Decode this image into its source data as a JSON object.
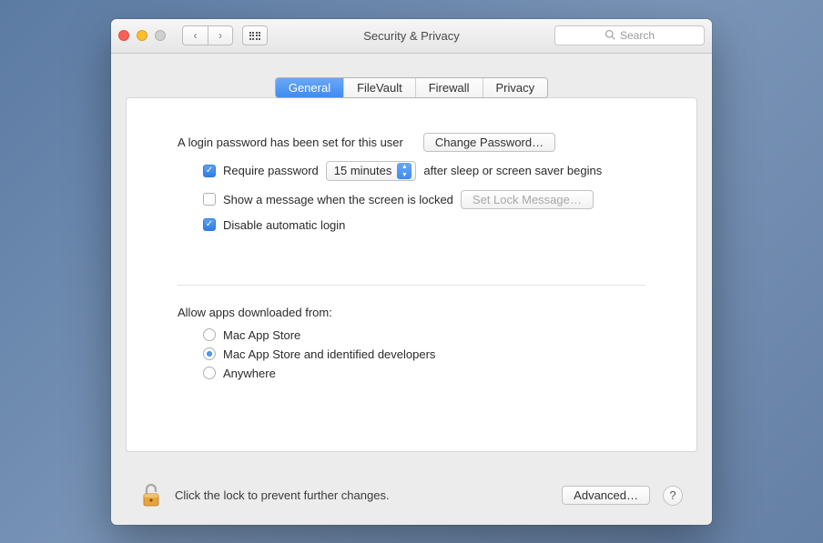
{
  "window": {
    "title": "Security & Privacy"
  },
  "search": {
    "placeholder": "Search"
  },
  "tabs": {
    "general": "General",
    "filevault": "FileVault",
    "firewall": "Firewall",
    "privacy": "Privacy",
    "active": "general"
  },
  "general": {
    "login_password_set": "A login password has been set for this user",
    "change_password": "Change Password…",
    "require_password_label": "Require password",
    "require_password_delay": "15 minutes",
    "require_password_suffix": "after sleep or screen saver begins",
    "require_password_checked": true,
    "show_message_label": "Show a message when the screen is locked",
    "show_message_checked": false,
    "set_lock_message": "Set Lock Message…",
    "disable_auto_login_label": "Disable automatic login",
    "disable_auto_login_checked": true,
    "allow_apps_heading": "Allow apps downloaded from:",
    "allow_apps_options": {
      "mas": "Mac App Store",
      "mas_dev": "Mac App Store and identified developers",
      "anywhere": "Anywhere"
    },
    "allow_apps_selected": "mas_dev"
  },
  "footer": {
    "lock_hint": "Click the lock to prevent further changes.",
    "advanced": "Advanced…"
  }
}
